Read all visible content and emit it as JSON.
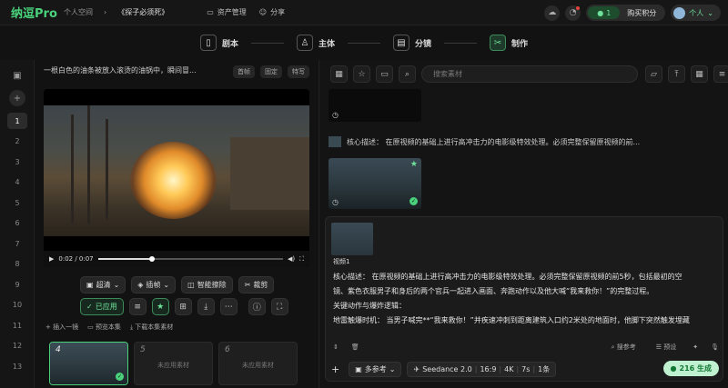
{
  "topbar": {
    "logo": "纳逗Pro",
    "breadcrumb": [
      "个人空间",
      "《探子必须死》"
    ],
    "asset_manage": "资产管理",
    "share": "分享",
    "credits": "1",
    "buy": "购买积分",
    "user": "个人"
  },
  "steps": [
    {
      "label": "剧本",
      "icon": "book-icon"
    },
    {
      "label": "主体",
      "icon": "person-icon"
    },
    {
      "label": "分镜",
      "icon": "clapper-icon"
    },
    {
      "label": "制作",
      "icon": "scissors-icon"
    }
  ],
  "sidebar": {
    "numbers": [
      "1",
      "2",
      "3",
      "4",
      "5",
      "6",
      "7",
      "8",
      "9",
      "10",
      "11",
      "12",
      "13"
    ],
    "selected": "1"
  },
  "left": {
    "desc": "一根白色的油条被放入滚烫的油锅中，瞬间冒...",
    "chips": [
      "首帧",
      "固定",
      "特写"
    ],
    "video": {
      "time": "0:02 / 0:07",
      "progress": 0.29
    },
    "tools": [
      "超清",
      "插帧",
      "智能擦除",
      "裁剪"
    ],
    "applied": "已应用",
    "links": [
      "插入一镜",
      "预览本集",
      "下载本集素材"
    ],
    "shots": [
      {
        "no": "4",
        "label": ""
      },
      {
        "no": "5",
        "label": "未应用素材"
      },
      {
        "no": "6",
        "label": "未应用素材"
      }
    ]
  },
  "right": {
    "search_placeholder": "搜索素材",
    "core_desc": "核心描述： 在原视频的基础上进行高冲击力的电影级特效处理。必须完整保留原视频的前...",
    "prompt_thumb_label": "视频1",
    "prompt_lines": [
      "核心描述： 在原视频的基础上进行高冲击力的电影级特效处理。必须完整保留原视频的前5秒，包括最初的空",
      "镜、紫色衣服男子和身后的两个官兵一起进入画面、奔跑动作以及他大喊“我来救你！”的完整过程。",
      "关键动作与爆炸逻辑：",
      "地雷触爆时机： 当男子喊完**“我来救你！”并疾速冲刺到距离建筑入口约2米处的地面时，他脚下突然触发埋藏"
    ],
    "search_ref": "搜参考",
    "preset": "预设",
    "multi_ref": "多参考",
    "model": "Seedance 2.0",
    "ratio": "16:9",
    "res": "4K",
    "duration": "7s",
    "count": "1条",
    "generate": "216 生成"
  }
}
